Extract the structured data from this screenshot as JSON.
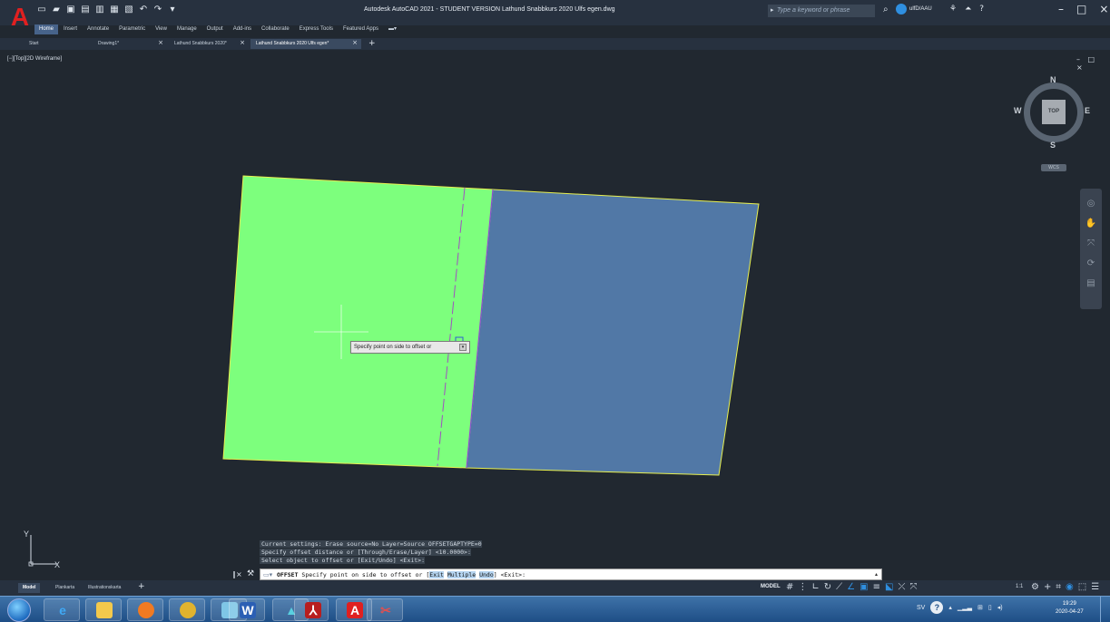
{
  "app": {
    "logo_letter": "A",
    "title": "Autodesk AutoCAD 2021 - STUDENT VERSION   Lathund Snabbkurs 2020 Ulfs egen.dwg",
    "search_placeholder": "Type a keyword or phrase",
    "user_name": "ulfD/AAU"
  },
  "ribbon": {
    "tabs": [
      "Home",
      "Insert",
      "Annotate",
      "Parametric",
      "View",
      "Manage",
      "Output",
      "Add-ins",
      "Collaborate",
      "Express Tools",
      "Featured Apps"
    ]
  },
  "doc_tabs": [
    {
      "label": "Start",
      "closable": false
    },
    {
      "label": "Drawing1*",
      "closable": true
    },
    {
      "label": "Lathund Snabbkurs 2020*",
      "closable": true
    },
    {
      "label": "Lathund Snabbkurs 2020 Ulfs egen*",
      "closable": true
    }
  ],
  "viewport": {
    "label": "[−][Top][2D Wireframe]",
    "controls": "– □ ×"
  },
  "viewcube": {
    "face": "TOP",
    "north": "N",
    "south": "S",
    "east": "E",
    "west": "W",
    "wcs": "WCS"
  },
  "ucs": {
    "x_label": "X",
    "y_label": "Y"
  },
  "tooltip": {
    "text": "Specify point on side to offset or"
  },
  "command": {
    "history": [
      "Current settings: Erase source=No  Layer=Source  OFFSETGAPTYPE=0",
      "Specify offset distance or [Through/Erase/Layer] <10.0000>:",
      "Select object to offset or [Exit/Undo] <Exit>:"
    ],
    "prompt_cmd": "OFFSET",
    "prompt_text": "Specify point on side to offset or [",
    "opt_exit": "Exit",
    "opt_multiple": "Multiple",
    "opt_undo": "Undo",
    "prompt_end": "] <Exit>:"
  },
  "layout_tabs": [
    "Model",
    "Plankarta",
    "Illustrationskarta"
  ],
  "status": {
    "model": "MODEL",
    "scale": "1:1"
  },
  "taskbar": {
    "tray_lang": "SV",
    "time": "19:29",
    "date": "2020-04-27"
  },
  "colors": {
    "green_region": "#7dff7d",
    "blue_region": "#5178a6",
    "outline": "#e8f050",
    "divider": "#a050c0"
  }
}
